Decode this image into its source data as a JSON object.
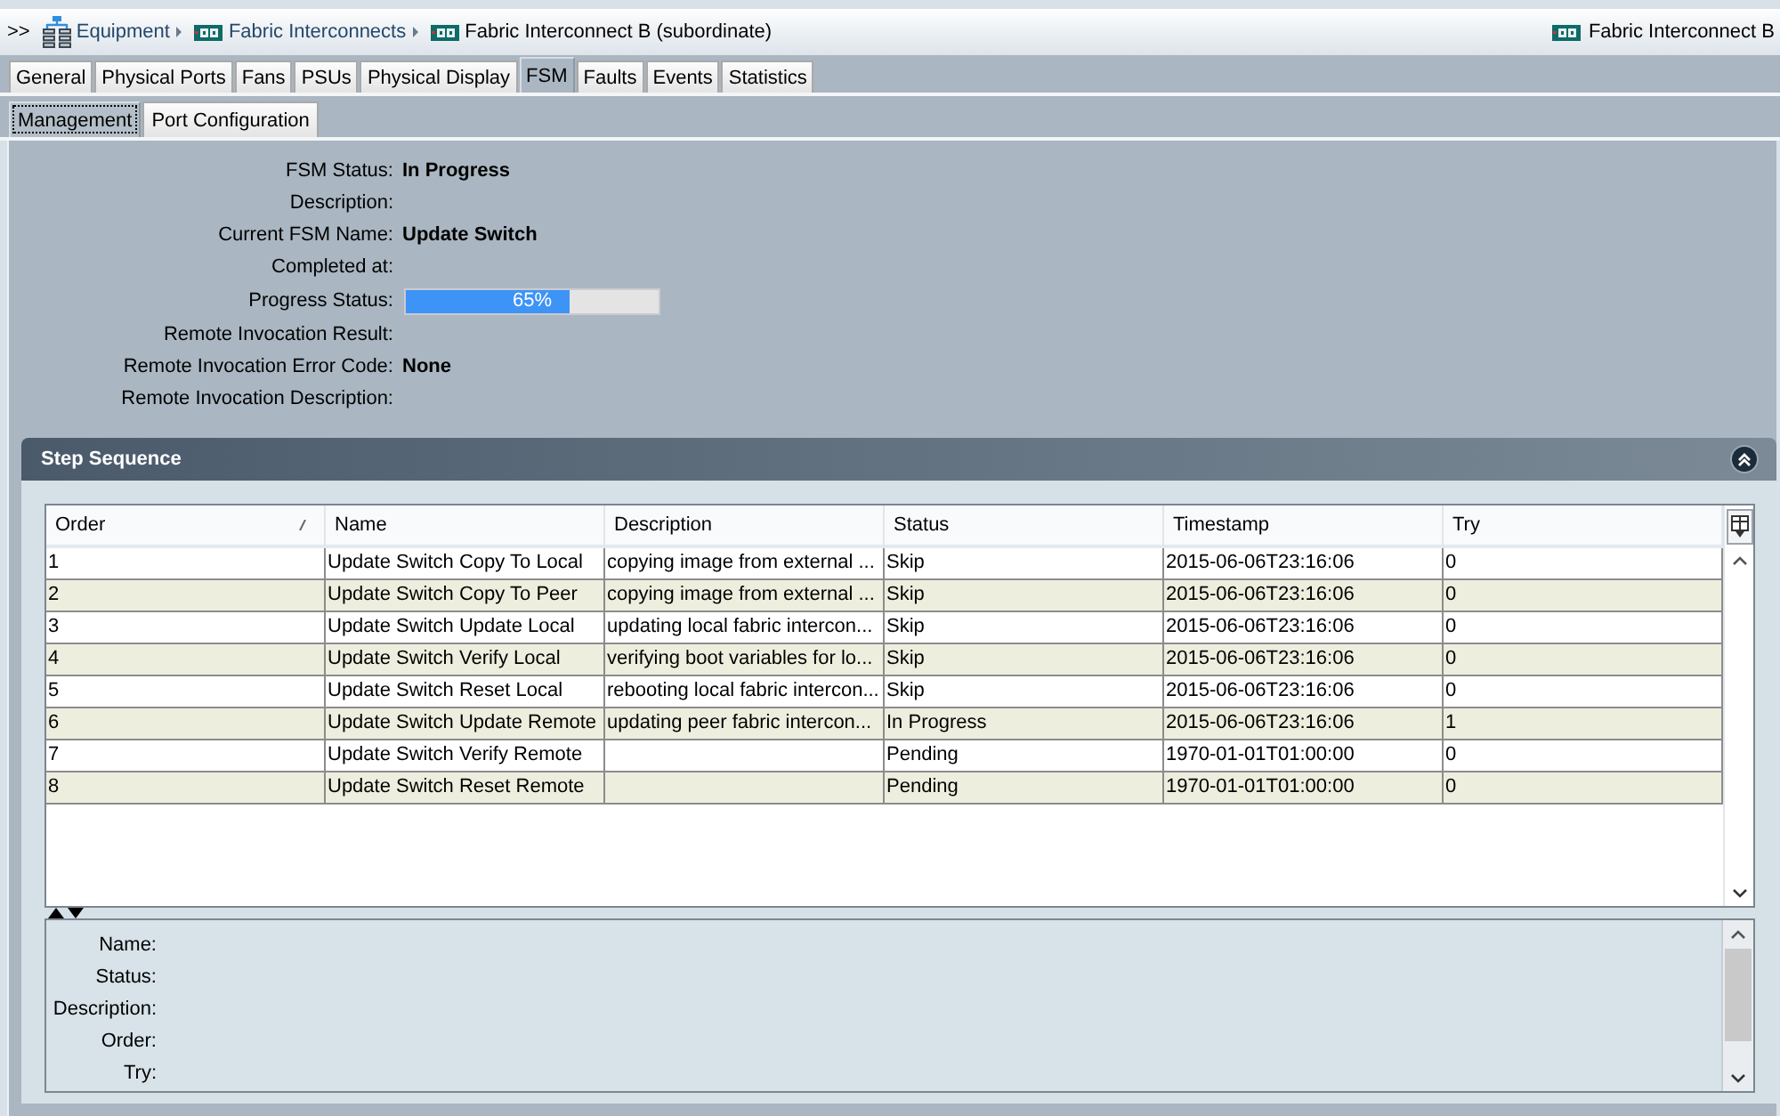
{
  "breadcrumb": {
    "toggle": ">>",
    "path": [
      {
        "label": "Equipment"
      },
      {
        "label": "Fabric Interconnects"
      },
      {
        "label": "Fabric Interconnect B (subordinate)"
      }
    ],
    "current": "Fabric Interconnect B"
  },
  "tabs": [
    {
      "label": "General",
      "selected": false
    },
    {
      "label": "Physical Ports",
      "selected": false
    },
    {
      "label": "Fans",
      "selected": false
    },
    {
      "label": "PSUs",
      "selected": false
    },
    {
      "label": "Physical Display",
      "selected": false
    },
    {
      "label": "FSM",
      "selected": true
    },
    {
      "label": "Faults",
      "selected": false
    },
    {
      "label": "Events",
      "selected": false
    },
    {
      "label": "Statistics",
      "selected": false
    }
  ],
  "subtabs": [
    {
      "label": "Management",
      "selected": true
    },
    {
      "label": "Port Configuration",
      "selected": false
    }
  ],
  "fsm": {
    "fields": [
      {
        "kind": "text",
        "label": "FSM Status:",
        "value": "In Progress"
      },
      {
        "kind": "text",
        "label": "Description:"
      },
      {
        "kind": "text",
        "label": "Current FSM Name:",
        "value": "Update Switch"
      },
      {
        "kind": "text",
        "label": "Completed at:"
      },
      {
        "kind": "progress",
        "label": "Progress Status:",
        "level": 0.65,
        "reading": "65%"
      },
      {
        "kind": "text",
        "label": "Remote Invocation Result:"
      },
      {
        "kind": "text",
        "label": "Remote Invocation Error Code:",
        "value": "None"
      },
      {
        "kind": "text",
        "label": "Remote Invocation Description:"
      }
    ]
  },
  "step_sequence": {
    "title": "Step Sequence",
    "columns": [
      {
        "label": "Order",
        "sorted": true
      },
      {
        "label": "Name",
        "sorted": false
      },
      {
        "label": "Description",
        "sorted": false
      },
      {
        "label": "Status",
        "sorted": false
      },
      {
        "label": "Timestamp",
        "sorted": false
      },
      {
        "label": "Try",
        "sorted": false
      }
    ],
    "rows": [
      {
        "order": "1",
        "name": "Update Switch Copy To Local",
        "description": "copying image from external ...",
        "status": "Skip",
        "timestamp": "2015-06-06T23:16:06",
        "try": "0"
      },
      {
        "order": "2",
        "name": "Update Switch Copy To Peer",
        "description": "copying image from external ...",
        "status": "Skip",
        "timestamp": "2015-06-06T23:16:06",
        "try": "0"
      },
      {
        "order": "3",
        "name": "Update Switch Update Local",
        "description": "updating local fabric intercon...",
        "status": "Skip",
        "timestamp": "2015-06-06T23:16:06",
        "try": "0"
      },
      {
        "order": "4",
        "name": "Update Switch Verify Local",
        "description": "verifying boot variables for lo...",
        "status": "Skip",
        "timestamp": "2015-06-06T23:16:06",
        "try": "0"
      },
      {
        "order": "5",
        "name": "Update Switch Reset Local",
        "description": "rebooting local fabric intercon...",
        "status": "Skip",
        "timestamp": "2015-06-06T23:16:06",
        "try": "0"
      },
      {
        "order": "6",
        "name": "Update Switch Update Remote",
        "description": "updating peer fabric intercon...",
        "status": "In Progress",
        "timestamp": "2015-06-06T23:16:06",
        "try": "1"
      },
      {
        "order": "7",
        "name": "Update Switch Verify Remote",
        "status": "Pending",
        "timestamp": "1970-01-01T01:00:00",
        "try": "0"
      },
      {
        "order": "8",
        "name": "Update Switch Reset Remote",
        "status": "Pending",
        "timestamp": "1970-01-01T01:00:00",
        "try": "0"
      }
    ],
    "details": [
      {
        "label": "Name:"
      },
      {
        "label": "Status:"
      },
      {
        "label": "Description:"
      },
      {
        "label": "Order:"
      },
      {
        "label": "Try:"
      }
    ]
  }
}
